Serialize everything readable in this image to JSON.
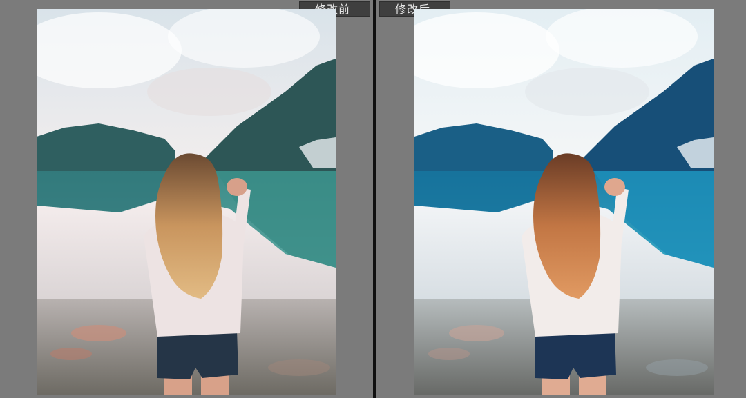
{
  "compare_view": {
    "before_label": "修改前",
    "after_label": "修改后"
  },
  "colors": {
    "background": "#7b7b7b",
    "divider": "#101010",
    "tag_bg": "#3f3f3f",
    "tag_text": "#e6e6e6"
  }
}
